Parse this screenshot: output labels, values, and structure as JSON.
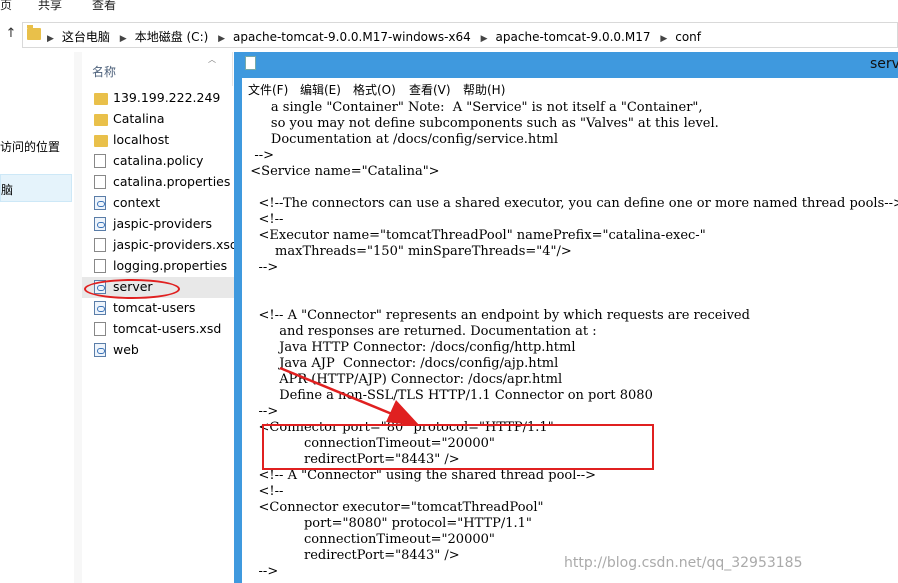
{
  "ribbon": {
    "tabs": [
      "页",
      "共享",
      "查看"
    ]
  },
  "address": {
    "crumbs": [
      "这台电脑",
      "本地磁盘 (C:)",
      "apache-tomcat-9.0.0.M17-windows-x64",
      "apache-tomcat-9.0.0.M17",
      "conf"
    ]
  },
  "nav": {
    "item1": "访问的位置",
    "item2": "脑"
  },
  "list": {
    "column_name": "名称",
    "files": [
      {
        "name": "139.199.222.249",
        "icon": "folder-icon"
      },
      {
        "name": "Catalina",
        "icon": "folder-icon"
      },
      {
        "name": "localhost",
        "icon": "folder-icon"
      },
      {
        "name": "catalina.policy",
        "icon": "document-icon"
      },
      {
        "name": "catalina.properties",
        "icon": "document-icon"
      },
      {
        "name": "context",
        "icon": "xml-file-icon"
      },
      {
        "name": "jaspic-providers",
        "icon": "xml-file-icon"
      },
      {
        "name": "jaspic-providers.xsd",
        "icon": "document-icon"
      },
      {
        "name": "logging.properties",
        "icon": "document-icon"
      },
      {
        "name": "server",
        "icon": "xml-file-icon"
      },
      {
        "name": "tomcat-users",
        "icon": "xml-file-icon"
      },
      {
        "name": "tomcat-users.xsd",
        "icon": "document-icon"
      },
      {
        "name": "web",
        "icon": "xml-file-icon"
      }
    ]
  },
  "notepad": {
    "title": "serv",
    "menu": [
      "文件(F)",
      "编辑(E)",
      "格式(O)",
      "查看(V)",
      "帮助(H)"
    ],
    "lines": [
      "       a single \"Container\" Note:  A \"Service\" is not itself a \"Container\",",
      "       so you may not define subcomponents such as \"Valves\" at this level.",
      "       Documentation at /docs/config/service.html",
      "   -->",
      "  <Service name=\"Catalina\">",
      "",
      "    <!--The connectors can use a shared executor, you can define one or more named thread pools-->",
      "    <!--",
      "    <Executor name=\"tomcatThreadPool\" namePrefix=\"catalina-exec-\"",
      "        maxThreads=\"150\" minSpareThreads=\"4\"/>",
      "    -->",
      "",
      "",
      "    <!-- A \"Connector\" represents an endpoint by which requests are received",
      "         and responses are returned. Documentation at :",
      "         Java HTTP Connector: /docs/config/http.html",
      "         Java AJP  Connector: /docs/config/ajp.html",
      "         APR (HTTP/AJP) Connector: /docs/apr.html",
      "         Define a non-SSL/TLS HTTP/1.1 Connector on port 8080",
      "    -->",
      "    <Connector port=\"80\" protocol=\"HTTP/1.1\"",
      "               connectionTimeout=\"20000\"",
      "               redirectPort=\"8443\" />",
      "    <!-- A \"Connector\" using the shared thread pool-->",
      "    <!--",
      "    <Connector executor=\"tomcatThreadPool\"",
      "               port=\"8080\" protocol=\"HTTP/1.1\"",
      "               connectionTimeout=\"20000\"",
      "               redirectPort=\"8443\" />",
      "    -->"
    ]
  },
  "watermark": "http://blog.csdn.net/qq_32953185",
  "colors": {
    "accent": "#3f99de",
    "annotation": "#e02020"
  }
}
